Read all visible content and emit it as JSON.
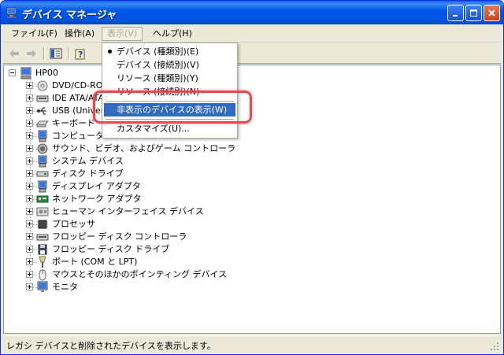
{
  "window": {
    "title": "デバイス マネージャ",
    "accent": "#0054E3"
  },
  "menu": [
    {
      "label": "ファイル(F)",
      "active": false
    },
    {
      "label": "操作(A)",
      "active": false
    },
    {
      "label": "表示(V)",
      "active": true
    },
    {
      "label": "ヘルプ(H)",
      "active": false
    }
  ],
  "toolbar": {
    "icons": [
      "back-arrow-icon",
      "forward-arrow-icon",
      "show-hide-tree-icon",
      "help-properties-icon"
    ]
  },
  "view_menu": {
    "items": [
      {
        "label": "デバイス (種類別)(E)",
        "checked": true
      },
      {
        "label": "デバイス (接続別)(V)",
        "checked": false
      },
      {
        "label": "リソース (種類別)(Y)",
        "checked": false
      },
      {
        "label": "リソース (接続別)(N)",
        "checked": false
      },
      {
        "label": "非表示のデバイスの表示(W)",
        "checked": false,
        "selected": true
      },
      {
        "label": "カスタマイズ(U)...",
        "checked": false
      }
    ],
    "selected_color": "#316AC5"
  },
  "tree": {
    "root": "HP00",
    "items": [
      {
        "label": "DVD/CD-ROM ドライブ",
        "icon": "cdrom-icon"
      },
      {
        "label": "IDE ATA/ATAPI コントローラ",
        "icon": "ide-controller-icon"
      },
      {
        "label": "USB (Universal Serial Bus) コントローラ",
        "icon": "usb-icon"
      },
      {
        "label": "キーボード",
        "icon": "keyboard-icon"
      },
      {
        "label": "コンピュータ",
        "icon": "computer-icon"
      },
      {
        "label": "サウンド、ビデオ、およびゲーム コントローラ",
        "icon": "sound-icon"
      },
      {
        "label": "システム デバイス",
        "icon": "system-device-icon"
      },
      {
        "label": "ディスク ドライブ",
        "icon": "disk-drive-icon"
      },
      {
        "label": "ディスプレイ アダプタ",
        "icon": "display-adapter-icon"
      },
      {
        "label": "ネットワーク アダプタ",
        "icon": "network-adapter-icon"
      },
      {
        "label": "ヒューマン インターフェイス デバイス",
        "icon": "hid-icon"
      },
      {
        "label": "プロセッサ",
        "icon": "processor-icon"
      },
      {
        "label": "フロッピー ディスク コントローラ",
        "icon": "floppy-controller-icon"
      },
      {
        "label": "フロッピー ディスク ドライブ",
        "icon": "floppy-drive-icon"
      },
      {
        "label": "ポート (COM と LPT)",
        "icon": "port-icon"
      },
      {
        "label": "マウスとそのほかのポインティング デバイス",
        "icon": "mouse-icon"
      },
      {
        "label": "モニタ",
        "icon": "monitor-icon"
      }
    ]
  },
  "status": {
    "text": "レガシ デバイスと削除されたデバイスを表示します。"
  },
  "highlight_color": "#E9484E"
}
